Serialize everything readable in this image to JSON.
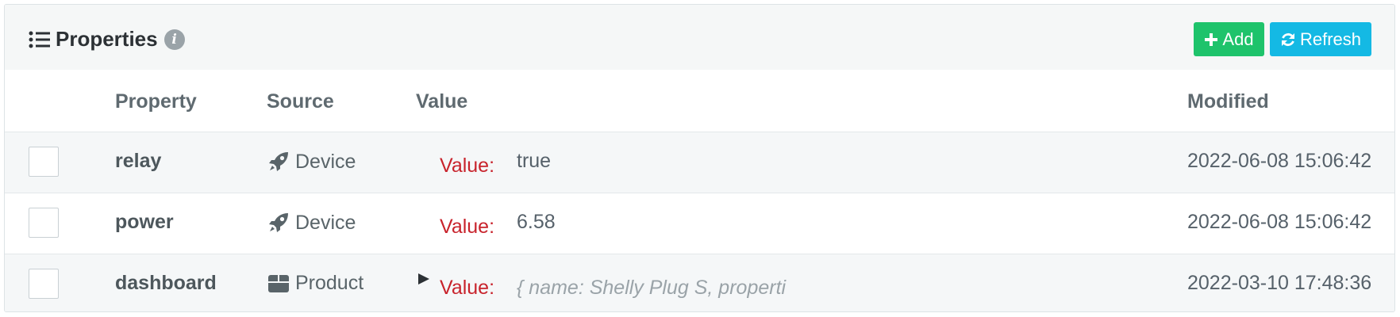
{
  "header": {
    "title": "Properties",
    "info_glyph": "i",
    "add_label": "Add",
    "refresh_label": "Refresh",
    "colors": {
      "add": "#1ec36b",
      "refresh": "#14b9e4"
    }
  },
  "columns": {
    "property": "Property",
    "source": "Source",
    "value": "Value",
    "modified": "Modified"
  },
  "rows": [
    {
      "property": "relay",
      "source": "Device",
      "source_icon": "rocket-icon",
      "value_label": "Value:",
      "value": "true",
      "modified": "2022-06-08 15:06:42",
      "checked": false
    },
    {
      "property": "power",
      "source": "Device",
      "source_icon": "rocket-icon",
      "value_label": "Value:",
      "value": "6.58",
      "modified": "2022-06-08 15:06:42",
      "checked": false
    },
    {
      "property": "dashboard",
      "source": "Product",
      "source_icon": "box-icon",
      "value_label": "Value:",
      "value": "{ name: Shelly Plug S, properti",
      "modified": "2022-03-10 17:48:36",
      "checked": false,
      "expandable": true
    }
  ]
}
